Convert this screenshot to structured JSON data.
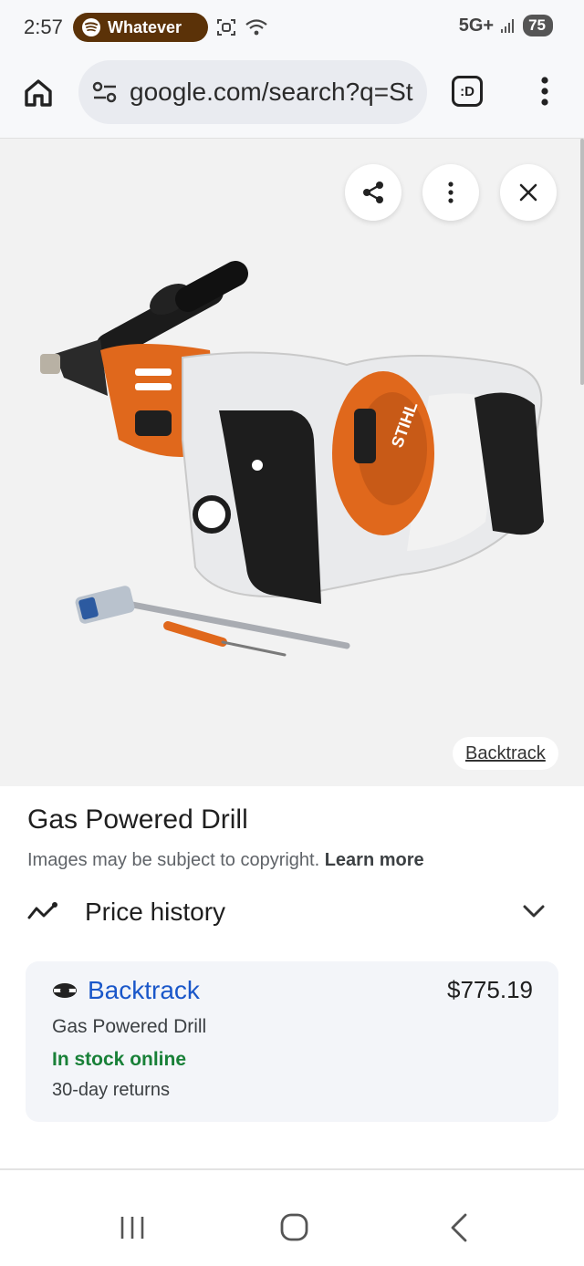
{
  "status_bar": {
    "time": "2:57",
    "media_app": "Whatever",
    "network": "5G+",
    "battery": "75"
  },
  "browser": {
    "url": "google.com/search?q=St",
    "tabs_indicator": ":D"
  },
  "viewer": {
    "source_chip": "Backtrack"
  },
  "details": {
    "title": "Gas Powered Drill",
    "copyright_text": "Images may be subject to copyright.",
    "learn_more": "Learn more",
    "price_history_label": "Price history"
  },
  "offer": {
    "merchant": "Backtrack",
    "price": "$775.19",
    "product": "Gas Powered Drill",
    "stock": "In stock online",
    "returns": "30-day returns"
  },
  "colors": {
    "accent_link": "#1a57c9",
    "stock_green": "#188038",
    "spotify_pill": "#5b3208",
    "drill_orange": "#e0681c"
  }
}
